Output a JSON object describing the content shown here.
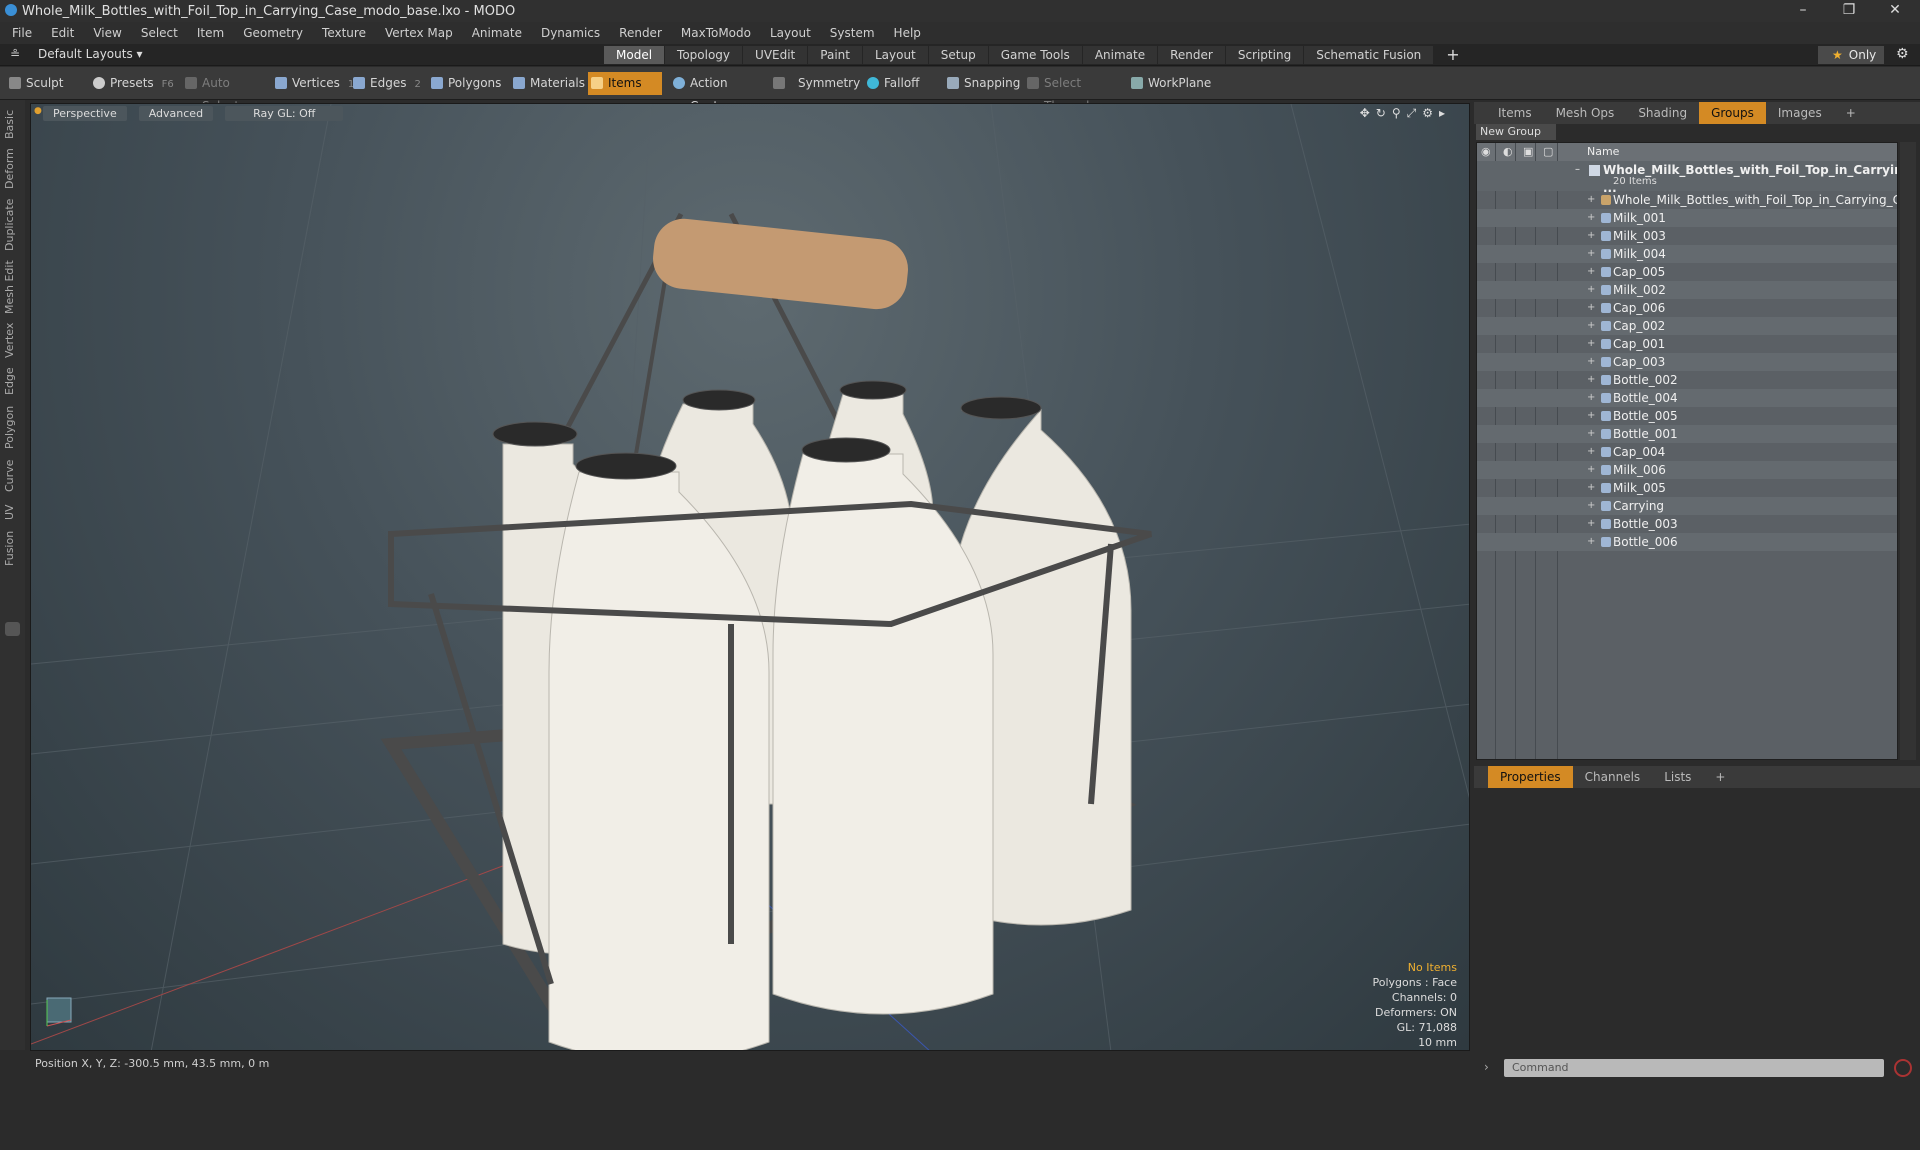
{
  "window": {
    "title": "Whole_Milk_Bottles_with_Foil_Top_in_Carrying_Case_modo_base.lxo - MODO",
    "minimize": "–",
    "restore": "❐",
    "close": "✕"
  },
  "menu": [
    "File",
    "Edit",
    "View",
    "Select",
    "Item",
    "Geometry",
    "Texture",
    "Vertex Map",
    "Animate",
    "Dynamics",
    "Render",
    "MaxToModo",
    "Layout",
    "System",
    "Help"
  ],
  "layout": {
    "selector": "Default Layouts ▾",
    "tabs": [
      "Model",
      "Topology",
      "UVEdit",
      "Paint",
      "Layout",
      "Setup",
      "Game Tools",
      "Animate",
      "Render",
      "Scripting",
      "Schematic Fusion"
    ],
    "active_tab": "Model",
    "plus": "+",
    "only": "Only"
  },
  "toolbar": {
    "sculpt": "Sculpt",
    "presets": "Presets",
    "presets_key": "F6",
    "auto_select": "Auto Select",
    "vertices": "Vertices",
    "vertices_key": "1",
    "edges": "Edges",
    "edges_key": "2",
    "polygons": "Polygons",
    "materials": "Materials",
    "items": "Items",
    "action_center": "Action Center",
    "symmetry": "Symmetry",
    "falloff": "Falloff",
    "snapping": "Snapping",
    "select_through": "Select Through",
    "workplane": "WorkPlane"
  },
  "left_tabs": [
    "Basic",
    "Deform",
    "Duplicate",
    "Mesh Edit",
    "Vertex",
    "Edge",
    "Polygon",
    "Curve",
    "UV",
    "Fusion"
  ],
  "viewport": {
    "view": "Perspective",
    "shading": "Advanced",
    "raygl": "Ray GL: Off",
    "info": {
      "selection": "No Items",
      "polygons": "Polygons : Face",
      "channels": "Channels: 0",
      "deformers": "Deformers: ON",
      "gl": "GL: 71,088",
      "scale": "10 mm"
    }
  },
  "status": {
    "position": "Position X, Y, Z:  -300.5 mm, 43.5 mm, 0 m"
  },
  "right_top_tabs": [
    "Items",
    "Mesh Ops",
    "Shading",
    "Groups",
    "Images",
    "+"
  ],
  "right_active_tab": "Groups",
  "groups": {
    "new_group": "New Group",
    "header_name": "Name",
    "root": "Whole_Milk_Bottles_with_Foil_Top_in_Carrying_C ...",
    "root_count": "20 Items",
    "items": [
      "Whole_Milk_Bottles_with_Foil_Top_in_Carrying_Case",
      "Milk_001",
      "Milk_003",
      "Milk_004",
      "Cap_005",
      "Milk_002",
      "Cap_006",
      "Cap_002",
      "Cap_001",
      "Cap_003",
      "Bottle_002",
      "Bottle_004",
      "Bottle_005",
      "Bottle_001",
      "Cap_004",
      "Milk_006",
      "Milk_005",
      "Carrying",
      "Bottle_003",
      "Bottle_006"
    ]
  },
  "props_tabs": [
    "Properties",
    "Channels",
    "Lists",
    "+"
  ],
  "props_active_tab": "Properties",
  "command": {
    "placeholder": "Command"
  },
  "colors": {
    "accent": "#d48a24",
    "viewport_bg": "#46525a",
    "panel": "#2b2b2b"
  }
}
